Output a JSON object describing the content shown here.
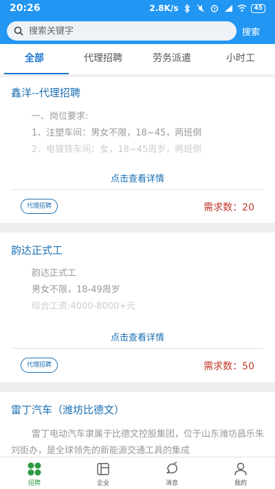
{
  "status": {
    "time": "20:26",
    "speed": "2.8K/s",
    "battery": "45"
  },
  "search": {
    "placeholder": "搜索关键字",
    "button": "搜索"
  },
  "tabs": [
    {
      "label": "全部"
    },
    {
      "label": "代理招聘"
    },
    {
      "label": "劳务派遣"
    },
    {
      "label": "小时工"
    }
  ],
  "cards": [
    {
      "title": "鑫洋--代理招聘",
      "lines": [
        "一、岗位要求:",
        "1、注塑车间：男女不限，18~45，两班倒",
        "2、电镀铁车间：女，18~45周岁，两班倒"
      ],
      "detail": "点击查看详情",
      "badge": "代理招聘",
      "demand": "需求数：20"
    },
    {
      "title": "韵达正式工",
      "lines": [
        "韵达正式工",
        "男女不限，18-49周岁",
        "综合工资:4000-8000+元"
      ],
      "detail": "点击查看详情",
      "badge": "代理招聘",
      "demand": "需求数：50"
    },
    {
      "title": "雷丁汽车（潍坊比德文）",
      "text": "雷丁电动汽车隶属于比德文控股集团，位于山东潍坊昌乐朱刘街办，是全球领先的新能源交通工具的集成"
    }
  ],
  "nav": [
    {
      "label": "招聘",
      "icon": "grid-icon"
    },
    {
      "label": "企业",
      "icon": "building-icon"
    },
    {
      "label": "消息",
      "icon": "message-icon"
    },
    {
      "label": "我的",
      "icon": "person-icon"
    }
  ],
  "colors": {
    "primary": "#2196f3",
    "accent": "#1a6fb3",
    "demand": "#c0392b",
    "nav_active": "#2e9b45"
  }
}
